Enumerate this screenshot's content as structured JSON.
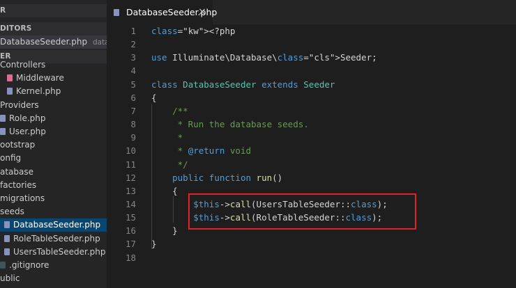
{
  "sidebar": {
    "explorer_title": "R",
    "open_editors_title": "DITORS",
    "open_editors": [
      {
        "name": "DatabaseSeeder.php",
        "path": "database..."
      }
    ],
    "folder_title": "ER",
    "tree": [
      {
        "label": "Controllers",
        "icon": "folder-icon"
      },
      {
        "label": "Middleware",
        "icon": "php-file-icon"
      },
      {
        "label": "Kernel.php",
        "icon": "php-file-icon"
      },
      {
        "label": "Providers",
        "icon": "folder-icon"
      },
      {
        "label": "Role.php",
        "icon": "php-file-icon"
      },
      {
        "label": "User.php",
        "icon": "php-file-icon"
      },
      {
        "label": "ootstrap",
        "icon": "folder-icon"
      },
      {
        "label": "onfig",
        "icon": "folder-icon"
      },
      {
        "label": "atabase",
        "icon": "folder-icon"
      },
      {
        "label": "factories",
        "icon": "folder-icon"
      },
      {
        "label": "migrations",
        "icon": "folder-icon"
      },
      {
        "label": "seeds",
        "icon": "folder-icon"
      },
      {
        "label": "DatabaseSeeder.php",
        "icon": "php-file-icon",
        "selected": true
      },
      {
        "label": "RoleTableSeeder.php",
        "icon": "php-file-icon"
      },
      {
        "label": "UsersTableSeeder.php",
        "icon": "php-file-icon"
      },
      {
        "label": ".gitignore",
        "icon": "git-file-icon"
      },
      {
        "label": "ublic",
        "icon": "folder-icon"
      }
    ]
  },
  "tab": {
    "label": "DatabaseSeeder.php",
    "close_glyph": "×"
  },
  "editor": {
    "line_numbers": [
      "1",
      "2",
      "3",
      "4",
      "5",
      "6",
      "7",
      "8",
      "9",
      "10",
      "11",
      "12",
      "13",
      "14",
      "15",
      "16",
      "17",
      "18"
    ],
    "lines": [
      "<?php",
      "",
      "use Illuminate\\Database\\Seeder;",
      "",
      "class DatabaseSeeder extends Seeder",
      "{",
      "    /**",
      "     * Run the database seeds.",
      "     *",
      "     * @return void",
      "     */",
      "    public function run()",
      "    {",
      "        $this->call(UsersTableSeeder::class);",
      "        $this->call(RoleTableSeeder::class);",
      "    }",
      "}",
      ""
    ]
  },
  "colors": {
    "keyword": "#569cd6",
    "class": "#4ec9b0",
    "function": "#dcdcaa",
    "variable": "#9cdcfe",
    "comment": "#6a9955",
    "highlight_border": "#e0242b",
    "selection": "#094771"
  }
}
